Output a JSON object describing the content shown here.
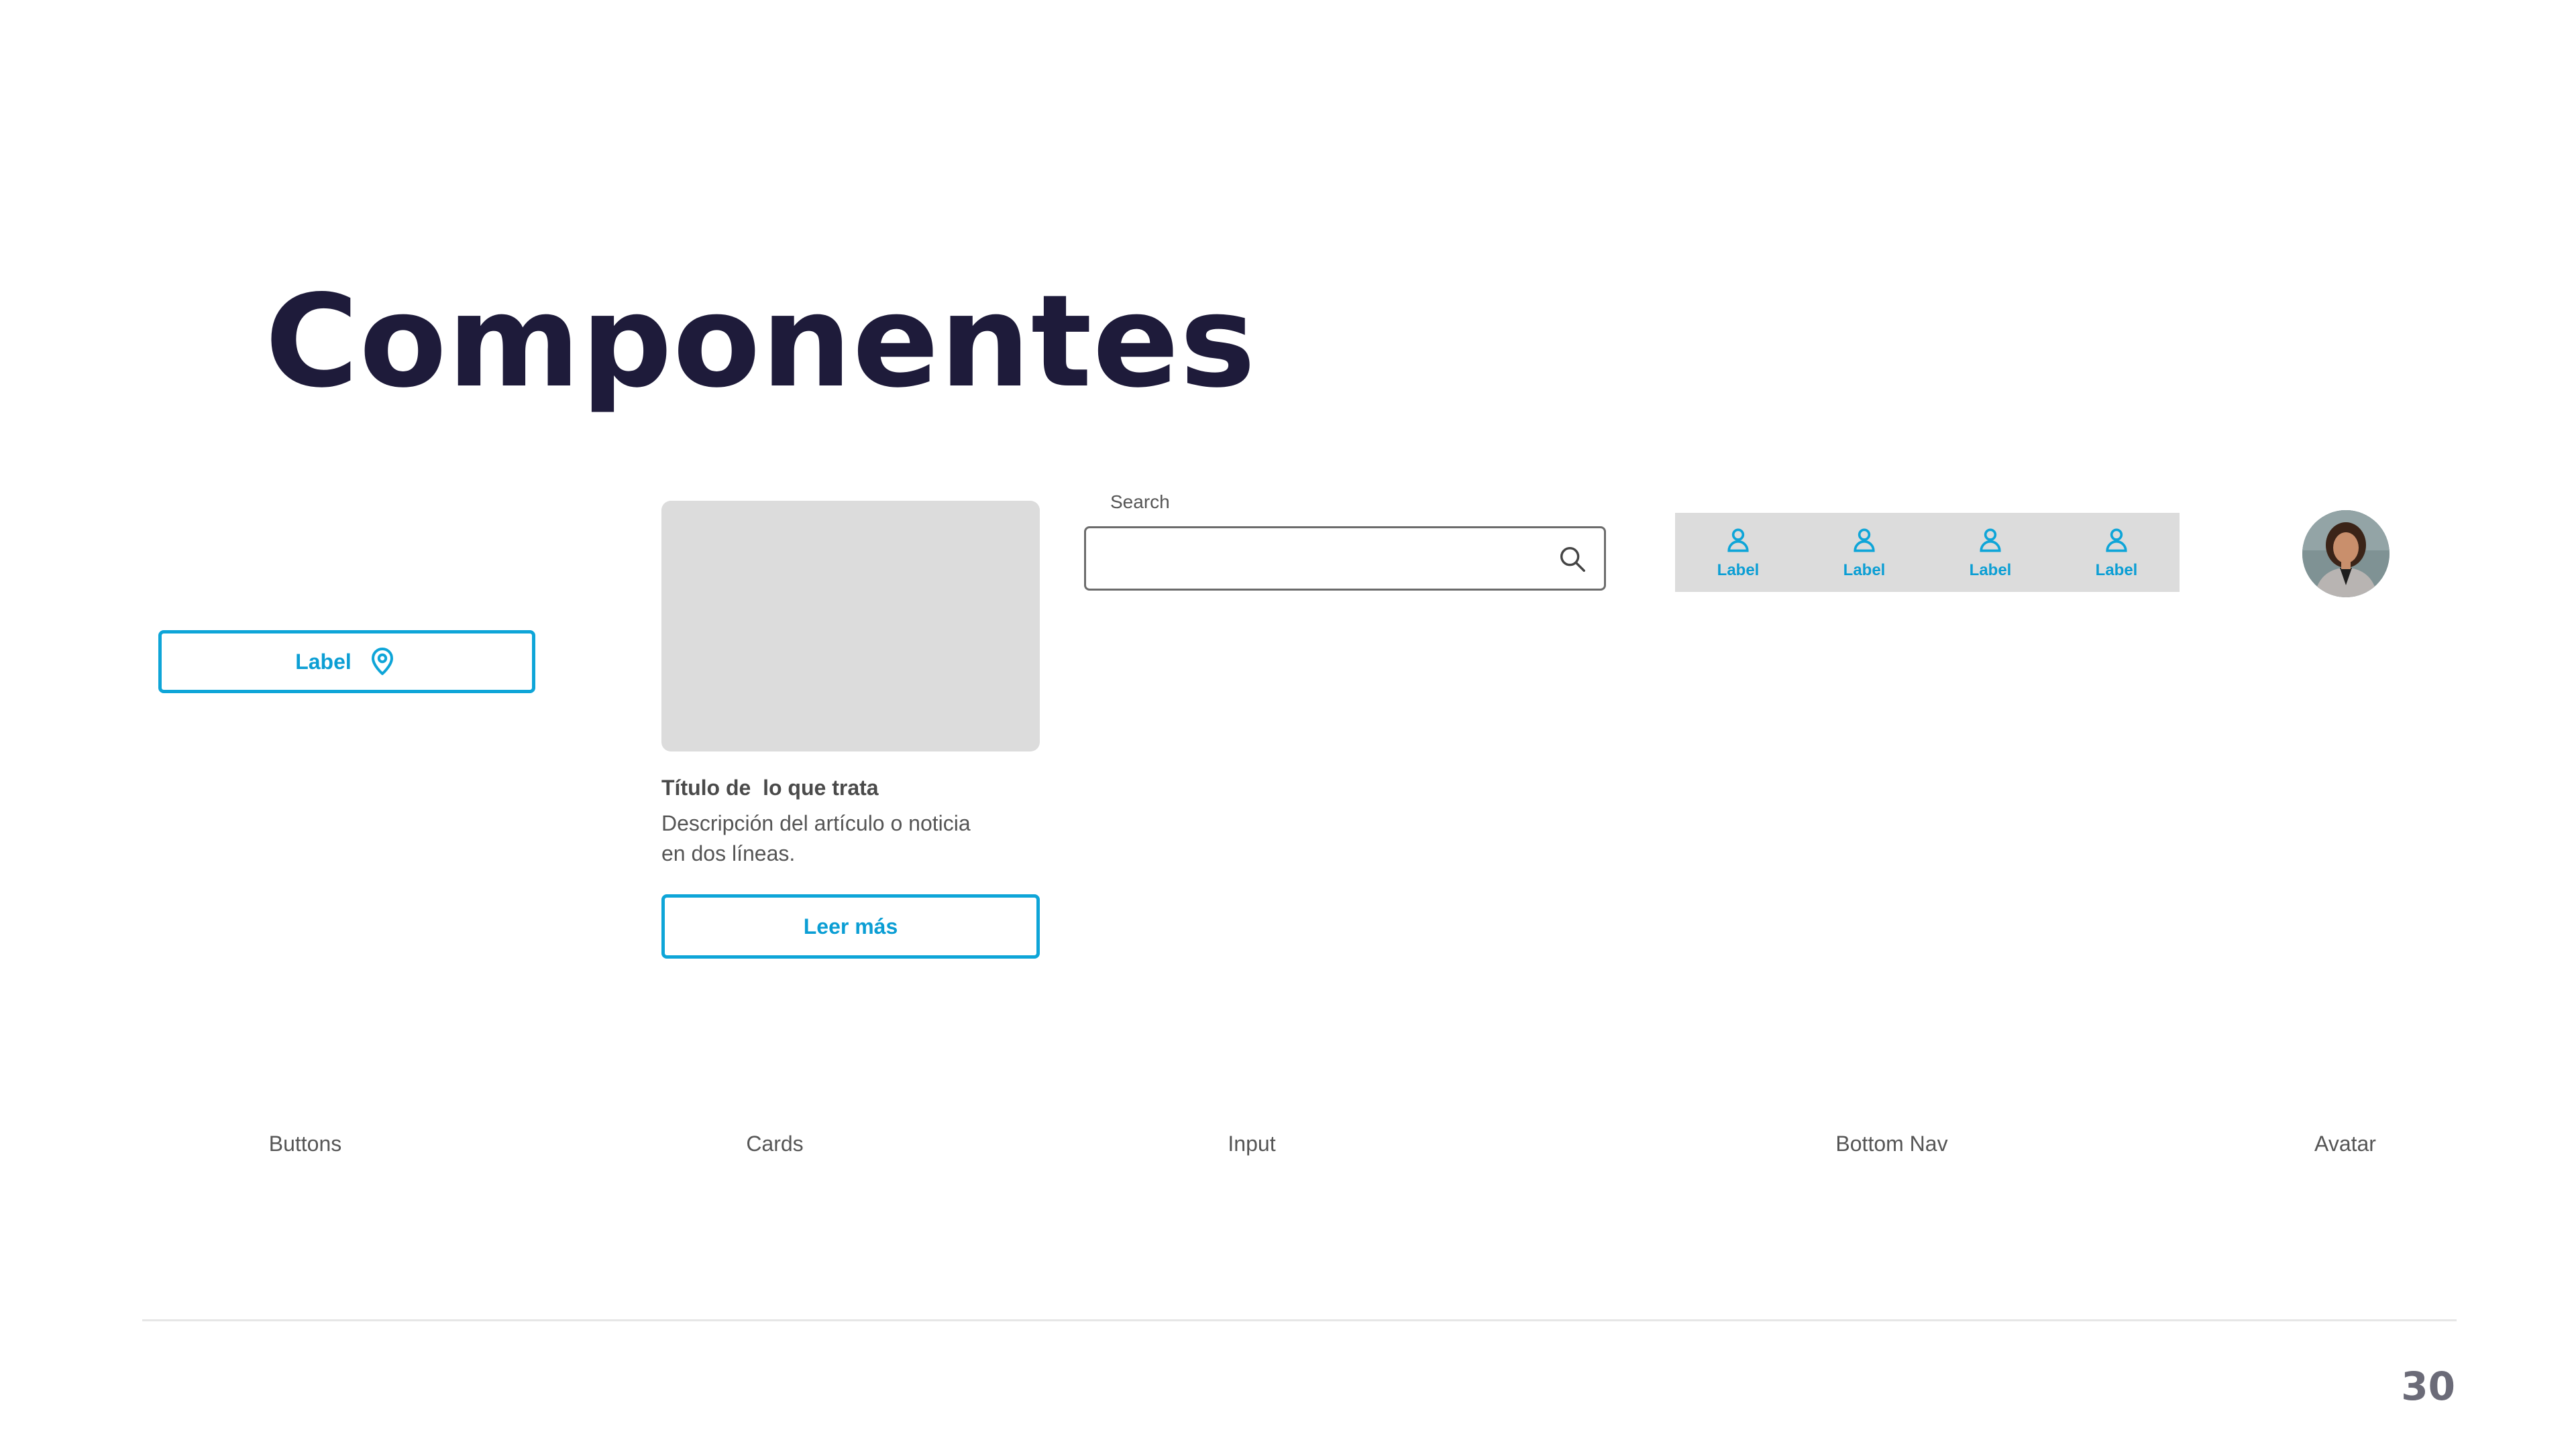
{
  "slide": {
    "title": "Componentes",
    "page_number": "30"
  },
  "buttons": {
    "label": "Label",
    "icon": "location-pin-icon"
  },
  "card": {
    "title": "Título de  lo que trata",
    "description_lines": [
      "Descripción del artículo o noticia",
      "en dos líneas."
    ],
    "button_label": "Leer más"
  },
  "input": {
    "label": "Search",
    "value": "",
    "placeholder": "",
    "icon": "search-icon"
  },
  "bottom_nav": {
    "items": [
      {
        "label": "Label",
        "icon": "user-icon"
      },
      {
        "label": "Label",
        "icon": "user-icon"
      },
      {
        "label": "Label",
        "icon": "user-icon"
      },
      {
        "label": "Label",
        "icon": "user-icon"
      }
    ]
  },
  "captions": {
    "buttons": "Buttons",
    "cards": "Cards",
    "input": "Input",
    "bottom_nav": "Bottom Nav",
    "avatar": "Avatar"
  },
  "colors": {
    "accent": "#0ea5d8",
    "title": "#1e1b3a",
    "placeholder_gray": "#dcdcdc"
  }
}
